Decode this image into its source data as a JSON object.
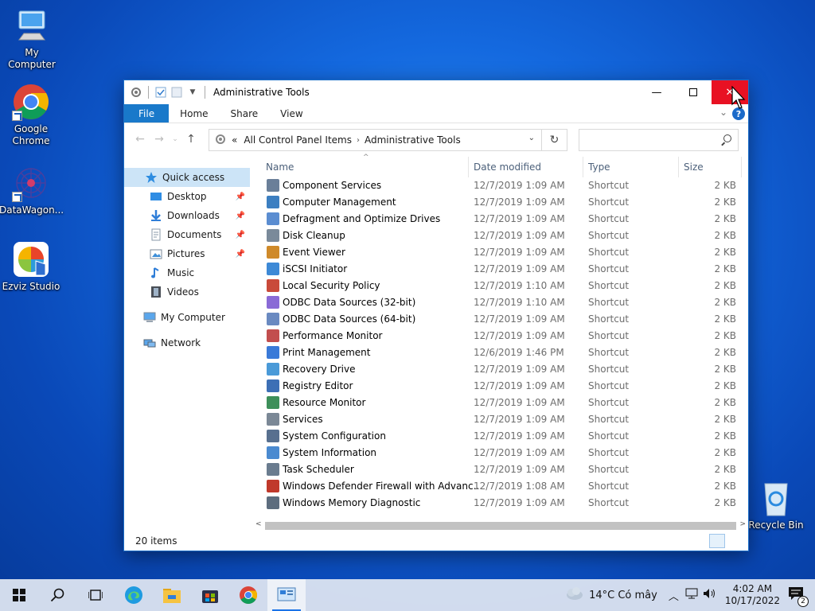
{
  "desktop": {
    "icons": [
      {
        "label": "My Computer"
      },
      {
        "label": "Google Chrome"
      },
      {
        "label": "DataWagon..."
      },
      {
        "label": "Ezviz Studio"
      },
      {
        "label": "Recycle Bin"
      }
    ]
  },
  "window": {
    "title": "Administrative Tools",
    "ribbon": {
      "file": "File",
      "home": "Home",
      "share": "Share",
      "view": "View",
      "help": "?"
    },
    "address": {
      "overflow": "«",
      "crumbs": [
        "All Control Panel Items",
        "Administrative Tools"
      ]
    },
    "search": {
      "placeholder": ""
    },
    "nav": [
      {
        "label": "Quick access"
      },
      {
        "label": "Desktop"
      },
      {
        "label": "Downloads"
      },
      {
        "label": "Documents"
      },
      {
        "label": "Pictures"
      },
      {
        "label": "Music"
      },
      {
        "label": "Videos"
      },
      {
        "label": "My Computer"
      },
      {
        "label": "Network"
      }
    ],
    "columns": {
      "name": "Name",
      "date": "Date modified",
      "type": "Type",
      "size": "Size"
    },
    "files": [
      {
        "name": "Component Services",
        "date": "12/7/2019 1:09 AM",
        "type": "Shortcut",
        "size": "2 KB"
      },
      {
        "name": "Computer Management",
        "date": "12/7/2019 1:09 AM",
        "type": "Shortcut",
        "size": "2 KB"
      },
      {
        "name": "Defragment and Optimize Drives",
        "date": "12/7/2019 1:09 AM",
        "type": "Shortcut",
        "size": "2 KB"
      },
      {
        "name": "Disk Cleanup",
        "date": "12/7/2019 1:09 AM",
        "type": "Shortcut",
        "size": "2 KB"
      },
      {
        "name": "Event Viewer",
        "date": "12/7/2019 1:09 AM",
        "type": "Shortcut",
        "size": "2 KB"
      },
      {
        "name": "iSCSI Initiator",
        "date": "12/7/2019 1:09 AM",
        "type": "Shortcut",
        "size": "2 KB"
      },
      {
        "name": "Local Security Policy",
        "date": "12/7/2019 1:10 AM",
        "type": "Shortcut",
        "size": "2 KB"
      },
      {
        "name": "ODBC Data Sources (32-bit)",
        "date": "12/7/2019 1:10 AM",
        "type": "Shortcut",
        "size": "2 KB"
      },
      {
        "name": "ODBC Data Sources (64-bit)",
        "date": "12/7/2019 1:09 AM",
        "type": "Shortcut",
        "size": "2 KB"
      },
      {
        "name": "Performance Monitor",
        "date": "12/7/2019 1:09 AM",
        "type": "Shortcut",
        "size": "2 KB"
      },
      {
        "name": "Print Management",
        "date": "12/6/2019 1:46 PM",
        "type": "Shortcut",
        "size": "2 KB"
      },
      {
        "name": "Recovery Drive",
        "date": "12/7/2019 1:09 AM",
        "type": "Shortcut",
        "size": "2 KB"
      },
      {
        "name": "Registry Editor",
        "date": "12/7/2019 1:09 AM",
        "type": "Shortcut",
        "size": "2 KB"
      },
      {
        "name": "Resource Monitor",
        "date": "12/7/2019 1:09 AM",
        "type": "Shortcut",
        "size": "2 KB"
      },
      {
        "name": "Services",
        "date": "12/7/2019 1:09 AM",
        "type": "Shortcut",
        "size": "2 KB"
      },
      {
        "name": "System Configuration",
        "date": "12/7/2019 1:09 AM",
        "type": "Shortcut",
        "size": "2 KB"
      },
      {
        "name": "System Information",
        "date": "12/7/2019 1:09 AM",
        "type": "Shortcut",
        "size": "2 KB"
      },
      {
        "name": "Task Scheduler",
        "date": "12/7/2019 1:09 AM",
        "type": "Shortcut",
        "size": "2 KB"
      },
      {
        "name": "Windows Defender Firewall with Advanc...",
        "date": "12/7/2019 1:08 AM",
        "type": "Shortcut",
        "size": "2 KB"
      },
      {
        "name": "Windows Memory Diagnostic",
        "date": "12/7/2019 1:09 AM",
        "type": "Shortcut",
        "size": "2 KB"
      }
    ],
    "status": "20 items"
  },
  "taskbar": {
    "weather": "14°C  Có mây",
    "time": "4:02 AM",
    "date": "10/17/2022",
    "notifications": "2"
  },
  "colors": {
    "accent": "#1979ca",
    "close": "#e81123",
    "selection": "#cce4f7"
  }
}
